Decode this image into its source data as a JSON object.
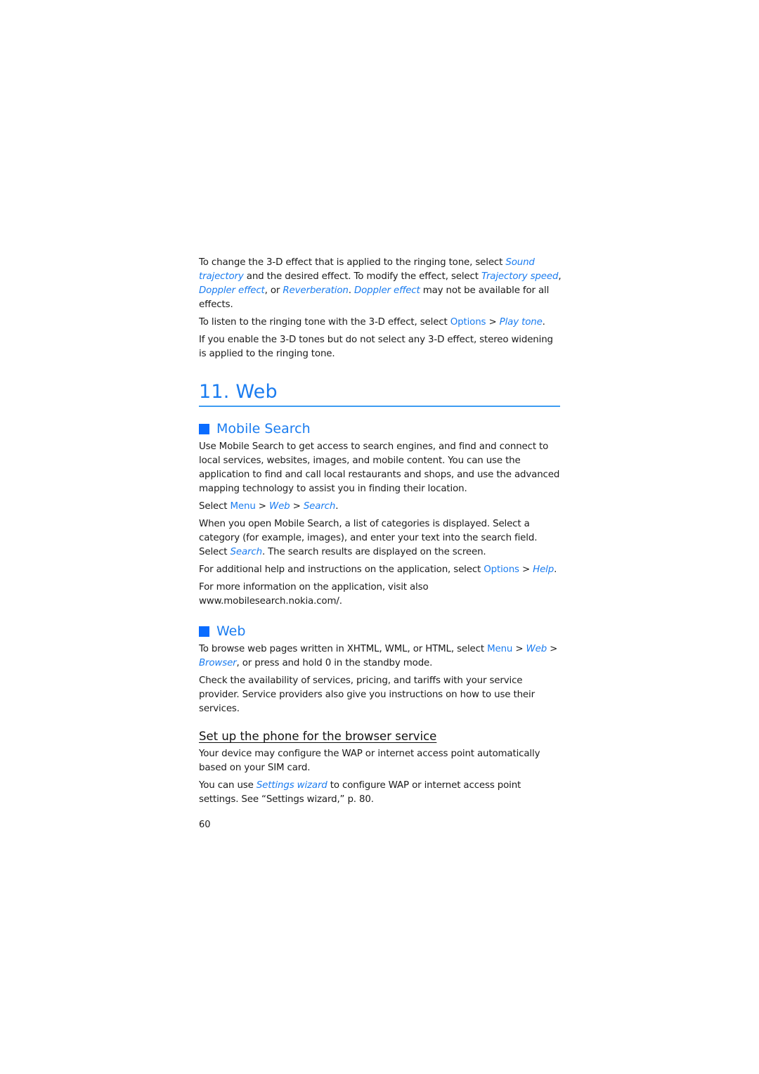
{
  "intro": {
    "p1": {
      "t1": "To change the 3-D effect that is applied to the ringing tone, select ",
      "l1": "Sound trajectory",
      "t2": " and the desired effect. To modify the effect, select ",
      "l2": "Trajectory speed",
      "t3": ", ",
      "l3": "Doppler effect",
      "t4": ", or ",
      "l4": "Reverberation",
      "t5": ". ",
      "l5": "Doppler effect",
      "t6": " may not be available for all effects."
    },
    "p2": {
      "t1": "To listen to the ringing tone with the 3-D effect, select ",
      "b1": "Options",
      "t2": " > ",
      "l1": "Play tone",
      "t3": "."
    },
    "p3": "If you enable the 3-D tones but do not select any 3-D effect, stereo widening is applied to the ringing tone."
  },
  "chapter": {
    "title": "11. Web"
  },
  "mobile_search": {
    "heading": "Mobile Search",
    "p1": "Use Mobile Search to get access to search engines, and find and connect to local services, websites, images, and mobile content. You can use the application to find and call local restaurants and shops, and use the advanced mapping technology to assist you in finding their location.",
    "p2": {
      "t1": "Select ",
      "b1": "Menu",
      "t2": " > ",
      "l1": "Web",
      "t3": " > ",
      "l2": "Search",
      "t4": "."
    },
    "p3": {
      "t1": "When you open Mobile Search, a list of categories is displayed. Select a category (for example, images), and enter your text into the search field. Select ",
      "l1": "Search",
      "t2": ". The search results are displayed on the screen."
    },
    "p4": {
      "t1": "For additional help and instructions on the application, select ",
      "b1": "Options",
      "t2": " > ",
      "l1": "Help",
      "t3": "."
    },
    "p5": "For more information on the application, visit also www.mobilesearch.nokia.com/."
  },
  "web": {
    "heading": "Web",
    "p1": {
      "t1": "To browse web pages written in XHTML, WML, or HTML, select ",
      "b1": "Menu",
      "t2": " > ",
      "l1": "Web",
      "t3": " > ",
      "l2": "Browser",
      "t4": ", or press and hold 0 in the standby mode."
    },
    "p2": "Check the availability of services, pricing, and tariffs with your service provider. Service providers also give you instructions on how to use their services."
  },
  "browser_setup": {
    "heading": "Set up the phone for the browser service",
    "p1": "Your device may configure the WAP or internet access point automatically based on your SIM card.",
    "p2": {
      "t1": "You can use ",
      "l1": "Settings wizard",
      "t2": " to configure WAP or internet access point settings. See “Settings wizard,” p. 80."
    }
  },
  "footer": {
    "page_number": "60"
  },
  "colors": {
    "accent": "#1a7cf0",
    "bullet": "#0a6cff",
    "rule": "#3d9cf2",
    "text": "#1a1a1a"
  }
}
